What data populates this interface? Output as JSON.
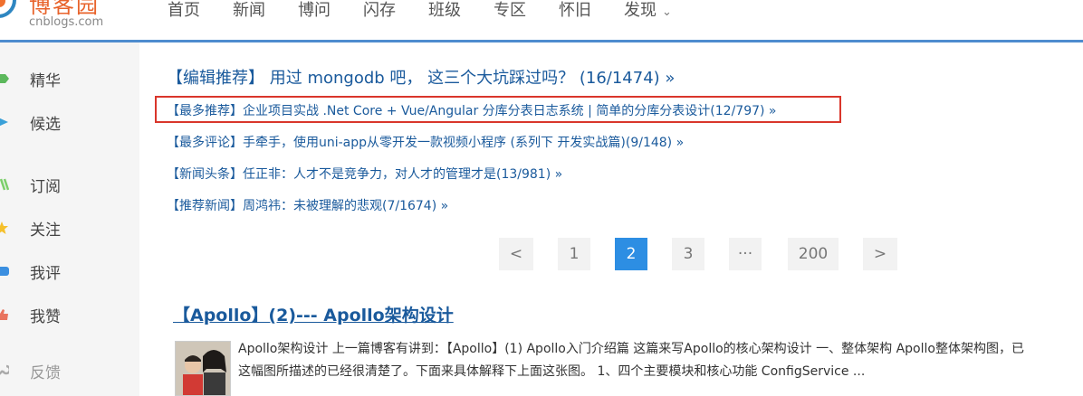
{
  "header": {
    "logo_title": "博客园",
    "logo_sub": "cnblogs.com",
    "nav": [
      "首页",
      "新闻",
      "博问",
      "闪存",
      "班级",
      "专区",
      "怀旧",
      "发现"
    ],
    "nav_more_icon": "chevron-down-icon"
  },
  "sidebar": {
    "items": [
      {
        "label": "精华",
        "icon": "gem-icon",
        "color": "#5cb85c"
      },
      {
        "label": "候选",
        "icon": "play-icon",
        "color": "#3aa0d8"
      },
      {
        "label": "订阅",
        "icon": "rss-icon",
        "color": "#7ccf6b"
      },
      {
        "label": "关注",
        "icon": "star-icon",
        "color": "#f5c02b"
      },
      {
        "label": "我评",
        "icon": "comment-icon",
        "color": "#3b8fe0"
      },
      {
        "label": "我赞",
        "icon": "thumb-up-icon",
        "color": "#e9735e"
      },
      {
        "label": "反馈",
        "icon": "wrench-icon",
        "color": "#aaaaaa"
      }
    ]
  },
  "headline": "【编辑推荐】 用过 mongodb 吧， 这三个大坑踩过吗？ (16/1474) »",
  "recommendations": [
    "【最多推荐】企业项目实战 .Net Core + Vue/Angular 分库分表日志系统 | 简单的分库分表设计(12/797) »",
    "【最多评论】手牵手，使用uni-app从零开发一款视频小程序 (系列下 开发实战篇)(9/148) »",
    "【新闻头条】任正非：人才不是竞争力，对人才的管理才是(13/981) »",
    "【推荐新闻】周鸿祎：未被理解的悲观(7/1674) »"
  ],
  "pager": {
    "prev": "<",
    "pages": [
      "1",
      "2",
      "3",
      "···",
      "200"
    ],
    "next": ">",
    "current": "2"
  },
  "post": {
    "title": "【Apollo】(2)--- Apollo架构设计",
    "summary_line1": "Apollo架构设计 上一篇博客有讲到：【Apollo】(1) Apollo入门介绍篇 这篇来写Apollo的核心架构设计 一、整体架构 Apollo整体架构图，已",
    "summary_line2": "这幅图所描述的已经很清楚了。下面来具体解释下上面这张图。 1、四个主要模块和核心功能 ConfigService ..."
  },
  "colors": {
    "link": "#1a5a9c",
    "accent": "#2d8ee3",
    "highlight_border": "#d9362b",
    "brand": "#e8632b"
  }
}
